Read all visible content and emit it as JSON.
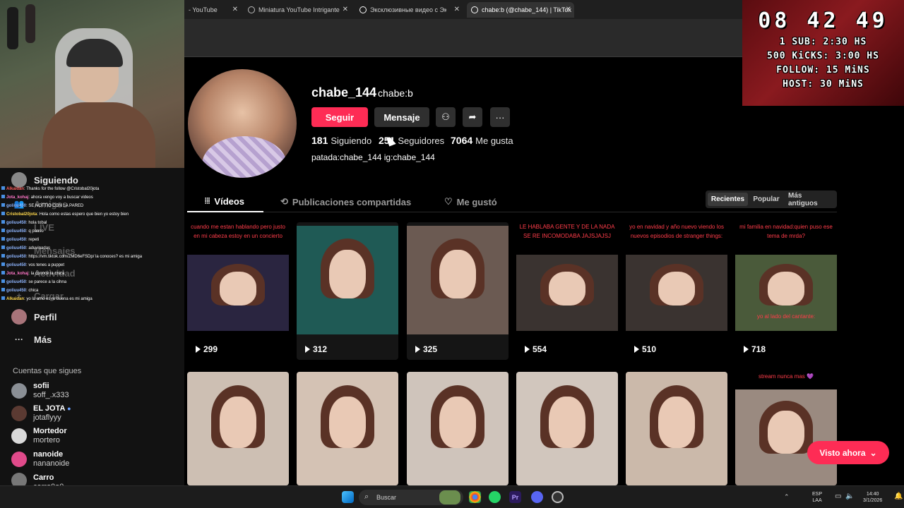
{
  "browser": {
    "tabs": [
      {
        "label": "- YouTube"
      },
      {
        "label": "Miniatura YouTube Intrigante"
      },
      {
        "label": "Эксклюзивные видео с Эксайт"
      },
      {
        "label": "chabe:b (@chabe_144) | TikTok"
      }
    ]
  },
  "timer": {
    "clock": "08 42 49",
    "lines": [
      "1 SUB: 2:30 HS",
      "500 KiCKS: 3:00 HS",
      "FOLLOW: 15 MiNS",
      "HOST: 30 MiNS"
    ]
  },
  "sidebar": {
    "nav": [
      {
        "label": "Siguiendo"
      },
      {
        "label": "Amigos"
      },
      {
        "label": "LIVE"
      },
      {
        "label": "Mensajes"
      },
      {
        "label": "Actividad"
      },
      {
        "label": "Cargar"
      },
      {
        "label": "Perfil"
      },
      {
        "label": "Más"
      }
    ],
    "follows_title": "Cuentas que sigues",
    "follows": [
      {
        "name": "sofii",
        "handle": "soff_.x333"
      },
      {
        "name": "EL JOTA",
        "handle": "jotaflyyy"
      },
      {
        "name": "Mortedor",
        "handle": "mortero"
      },
      {
        "name": "nanoide",
        "handle": "nananoide"
      },
      {
        "name": "Carro",
        "handle": "carro0o0"
      }
    ]
  },
  "chat": [
    {
      "user": "Alkaidan",
      "msg": ": Thanks for the follow @Cristobal20jota"
    },
    {
      "user": "Jota_kohaj",
      "msg": ": ahora vengo voy a buscar videos"
    },
    {
      "user": "goliuu450",
      "msg": ": SE NOTTIO CON LA PARED"
    },
    {
      "user": "Cristobal20jota",
      "msg": ": Hola como estas espero que bien yo estoy bien"
    },
    {
      "user": "goliuu450",
      "msg": ": hola tobal"
    },
    {
      "user": "goliuu450",
      "msg": ": q paaso"
    },
    {
      "user": "goliuu450",
      "msg": ": repeti"
    },
    {
      "user": "goliuu450",
      "msg": ": aduvinadas"
    },
    {
      "user": "goliuu450",
      "msg": ": https://vm.tiktok.com/ZMD6eFSDp/ la conoces? es mi amiga"
    },
    {
      "user": "goliuu450",
      "msg": ": vos tenes a puppet"
    },
    {
      "user": "Jota_kohaj",
      "msg": ": la conoce la chica"
    },
    {
      "user": "goliuu450",
      "msg": ": se parece a la cihna"
    },
    {
      "user": "goliuu450",
      "msg": ": chica"
    },
    {
      "user": "Alkaidan",
      "msg": ": yo la amo es re buena es mi amiga"
    }
  ],
  "profile": {
    "username": "chabe_144",
    "nickname": "chabe:b",
    "follow_label": "Seguir",
    "message_label": "Mensaje",
    "following_count": "181",
    "following_label": "Siguiendo",
    "followers_count": "251",
    "followers_label": "Seguidores",
    "likes_count": "7064",
    "likes_label": "Me gusta",
    "bio": "patada:chabe_144 ig:chabe_144"
  },
  "tabs": {
    "videos": "Vídeos",
    "reposts": "Publicaciones compartidas",
    "liked": "Me gustó"
  },
  "sort": [
    "Recientes",
    "Popular",
    "Más antiguos"
  ],
  "videos": [
    {
      "caption": "cuando me estan hablando pero justo en mi cabeza estoy en un concierto",
      "views": "299",
      "bg": "#2a2540"
    },
    {
      "caption": "",
      "views": "312",
      "bg": "#1f5a55"
    },
    {
      "caption": "",
      "views": "325",
      "bg": "#6b5a52"
    },
    {
      "caption": "LE HABLABA GENTE Y DE LA NADA SE RE INCOMODABA JAJSJAJSJ",
      "views": "554",
      "bg": "#3a3330"
    },
    {
      "caption": "yo en navidad y año nuevo viendo los nuevos episodios de stranger things:",
      "views": "510",
      "bg": "#3a3330"
    },
    {
      "caption": "mi familia en navidad:quien puso ese tema de mrda?",
      "views": "718",
      "bg": "#4a5a3a"
    },
    {
      "caption": "",
      "views": "",
      "bg": "#cdbfb3"
    },
    {
      "caption": "",
      "views": "",
      "bg": "#d4c2b4"
    },
    {
      "caption": "",
      "views": "",
      "bg": "#cfc4bb"
    },
    {
      "caption": "",
      "views": "",
      "bg": "#d1c6bd"
    },
    {
      "caption": "",
      "views": "",
      "bg": "#cbb9aa"
    },
    {
      "caption": "stream nunca mas 💜",
      "views": "",
      "bg": "#9a8a80"
    }
  ],
  "overlay_text": "yo al lado del cantante:",
  "seen_label": "Visto ahora",
  "taskbar": {
    "search_placeholder": "Buscar",
    "lang_top": "ESP",
    "lang_bottom": "LAA",
    "time": "14:40",
    "date": "3/1/2026"
  }
}
